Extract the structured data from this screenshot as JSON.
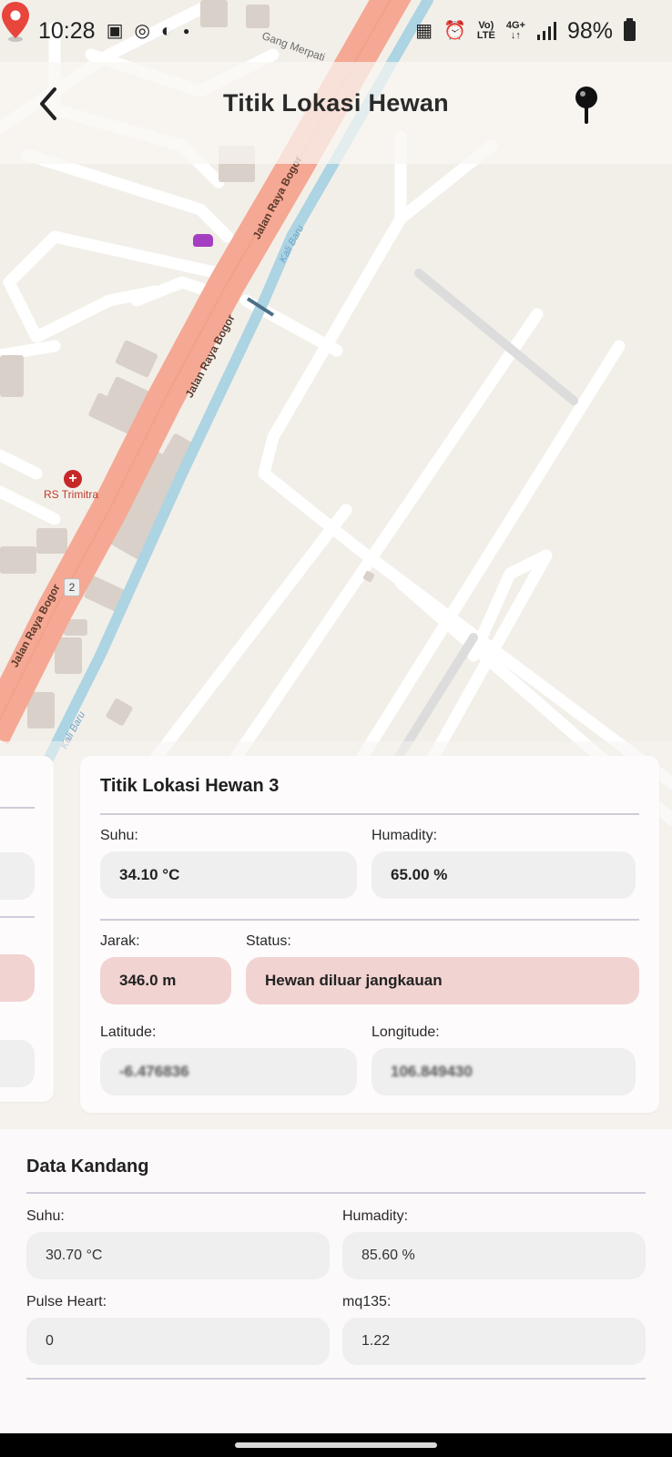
{
  "status_bar": {
    "time": "10:28",
    "network_top": "Vo)",
    "network_bottom": "LTE",
    "data_top": "4G+",
    "data_bottom": "↓↑",
    "battery": "98%"
  },
  "app_bar": {
    "title": "Titik Lokasi Hewan"
  },
  "map": {
    "labels": {
      "gang_merpati": "Gang Merpati",
      "jalan_raya_bogor": "Jalan Raya Bogor",
      "kali_baru": "Kali Baru",
      "hospital": "RS Trimitra",
      "route_number": "2"
    },
    "marker_color": "#e8453c",
    "road_color": "#f5a893"
  },
  "hewan_card": {
    "title": "Titik Lokasi Hewan 3",
    "suhu_label": "Suhu:",
    "suhu_value": "34.10 °C",
    "humidity_label": "Humadity:",
    "humidity_value": "65.00 %",
    "jarak_label": "Jarak:",
    "jarak_value": "346.0 m",
    "status_label": "Status:",
    "status_value": "Hewan diluar jangkauan",
    "latitude_label": "Latitude:",
    "latitude_value": "-6.476836",
    "longitude_label": "Longitude:",
    "longitude_value": "106.849430",
    "warn_color": "#f1d3d2"
  },
  "kandang": {
    "title": "Data Kandang",
    "suhu_label": "Suhu:",
    "suhu_value": "30.70 °C",
    "humidity_label": "Humadity:",
    "humidity_value": "85.60 %",
    "pulse_label": "Pulse Heart:",
    "pulse_value": "0",
    "mq_label": "mq135:",
    "mq_value": "1.22"
  }
}
